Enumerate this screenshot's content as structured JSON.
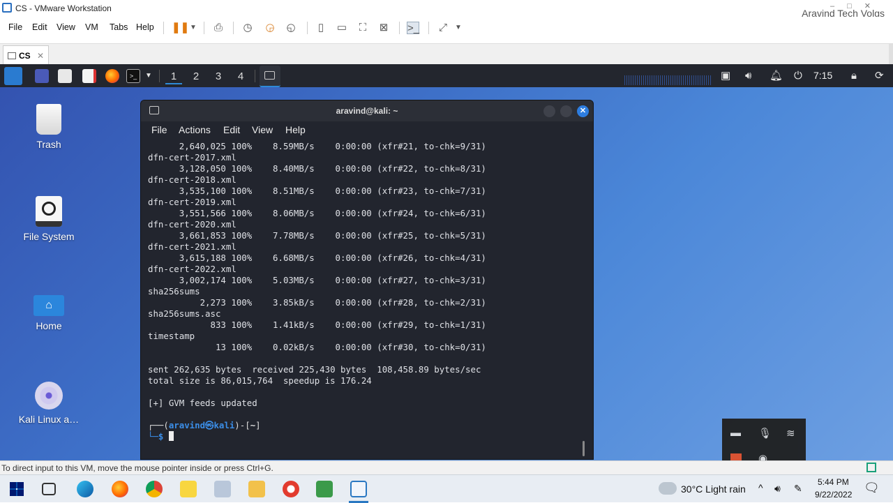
{
  "vmware": {
    "title": "CS - VMware Workstation",
    "watermark": "Aravind Tech Volgs",
    "menu": [
      "File",
      "Edit",
      "View",
      "VM",
      "Tabs",
      "Help"
    ],
    "tab": {
      "label": "CS",
      "close": "✕"
    },
    "status_text": "To direct input to this VM, move the mouse pointer inside or press Ctrl+G."
  },
  "kali_panel": {
    "workspaces": [
      "1",
      "2",
      "3",
      "4"
    ],
    "clock": "7:15"
  },
  "desktop_icons": [
    {
      "label": "Trash",
      "icon": "trash-icon"
    },
    {
      "label": "File System",
      "icon": "drive-icon"
    },
    {
      "label": "Home",
      "icon": "home-folder-icon"
    },
    {
      "label": "Kali Linux a…",
      "icon": "disc-icon"
    }
  ],
  "terminal": {
    "title": "aravind@kali: ~",
    "menu": [
      "File",
      "Actions",
      "Edit",
      "View",
      "Help"
    ],
    "lines": [
      "      2,640,025 100%    8.59MB/s    0:00:00 (xfr#21, to-chk=9/31)",
      "dfn-cert-2017.xml",
      "      3,128,050 100%    8.40MB/s    0:00:00 (xfr#22, to-chk=8/31)",
      "dfn-cert-2018.xml",
      "      3,535,100 100%    8.51MB/s    0:00:00 (xfr#23, to-chk=7/31)",
      "dfn-cert-2019.xml",
      "      3,551,566 100%    8.06MB/s    0:00:00 (xfr#24, to-chk=6/31)",
      "dfn-cert-2020.xml",
      "      3,661,853 100%    7.78MB/s    0:00:00 (xfr#25, to-chk=5/31)",
      "dfn-cert-2021.xml",
      "      3,615,188 100%    6.68MB/s    0:00:00 (xfr#26, to-chk=4/31)",
      "dfn-cert-2022.xml",
      "      3,002,174 100%    5.03MB/s    0:00:00 (xfr#27, to-chk=3/31)",
      "sha256sums",
      "          2,273 100%    3.85kB/s    0:00:00 (xfr#28, to-chk=2/31)",
      "sha256sums.asc",
      "            833 100%    1.41kB/s    0:00:00 (xfr#29, to-chk=1/31)",
      "timestamp",
      "             13 100%    0.02kB/s    0:00:00 (xfr#30, to-chk=0/31)",
      "",
      "sent 262,635 bytes  received 225,430 bytes  108,458.89 bytes/sec",
      "total size is 86,015,764  speedup is 176.24",
      "",
      "[+] GVM feeds updated",
      ""
    ],
    "prompt_user": "aravind㉿kali",
    "prompt_path": "~",
    "prompt_top_prefix": "┌──(",
    "prompt_top_mid": ")-[",
    "prompt_top_suffix": "]",
    "prompt_bottom": "└─$ "
  },
  "taskbar": {
    "weather": "30°C  Light rain",
    "time": "5:44 PM",
    "date": "9/22/2022"
  }
}
